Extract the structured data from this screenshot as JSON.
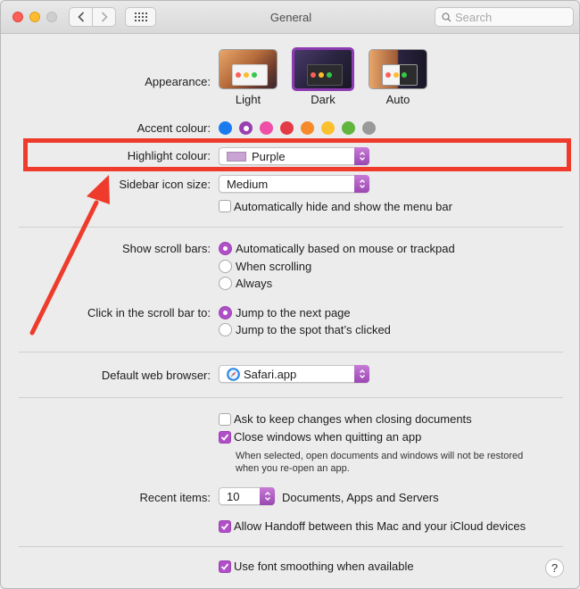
{
  "window": {
    "title": "General"
  },
  "search": {
    "placeholder": "Search"
  },
  "appearance": {
    "label": "Appearance:",
    "options": [
      "Light",
      "Dark",
      "Auto"
    ],
    "selected": "Dark"
  },
  "accent": {
    "label": "Accent colour:",
    "colors": [
      "#1a7bf0",
      "#9a3fb0",
      "#ef4fa6",
      "#e33a45",
      "#f6892a",
      "#fbc02d",
      "#5fb53e",
      "#999999"
    ],
    "selected_index": 1
  },
  "highlight": {
    "label": "Highlight colour:",
    "value": "Purple"
  },
  "sidebar_icon_size": {
    "label": "Sidebar icon size:",
    "value": "Medium"
  },
  "menu_bar": {
    "label": "Automatically hide and show the menu bar",
    "checked": false
  },
  "scroll_bars": {
    "label": "Show scroll bars:",
    "options": [
      "Automatically based on mouse or trackpad",
      "When scrolling",
      "Always"
    ],
    "selected_index": 0
  },
  "click_scroll": {
    "label": "Click in the scroll bar to:",
    "options": [
      "Jump to the next page",
      "Jump to the spot that’s clicked"
    ],
    "selected_index": 0
  },
  "browser": {
    "label": "Default web browser:",
    "value": "Safari.app"
  },
  "documents": {
    "ask_keep": {
      "label": "Ask to keep changes when closing documents",
      "checked": false
    },
    "close_windows": {
      "label": "Close windows when quitting an app",
      "checked": true
    },
    "note_line1": "When selected, open documents and windows will not be restored",
    "note_line2": "when you re-open an app."
  },
  "recent": {
    "label": "Recent items:",
    "value": "10",
    "suffix": "Documents, Apps and Servers"
  },
  "handoff": {
    "label": "Allow Handoff between this Mac and your iCloud devices",
    "checked": true
  },
  "font_smoothing": {
    "label": "Use font smoothing when available",
    "checked": true
  },
  "help": {
    "label": "?"
  },
  "annotation": {
    "color": "#ee3b2b"
  }
}
